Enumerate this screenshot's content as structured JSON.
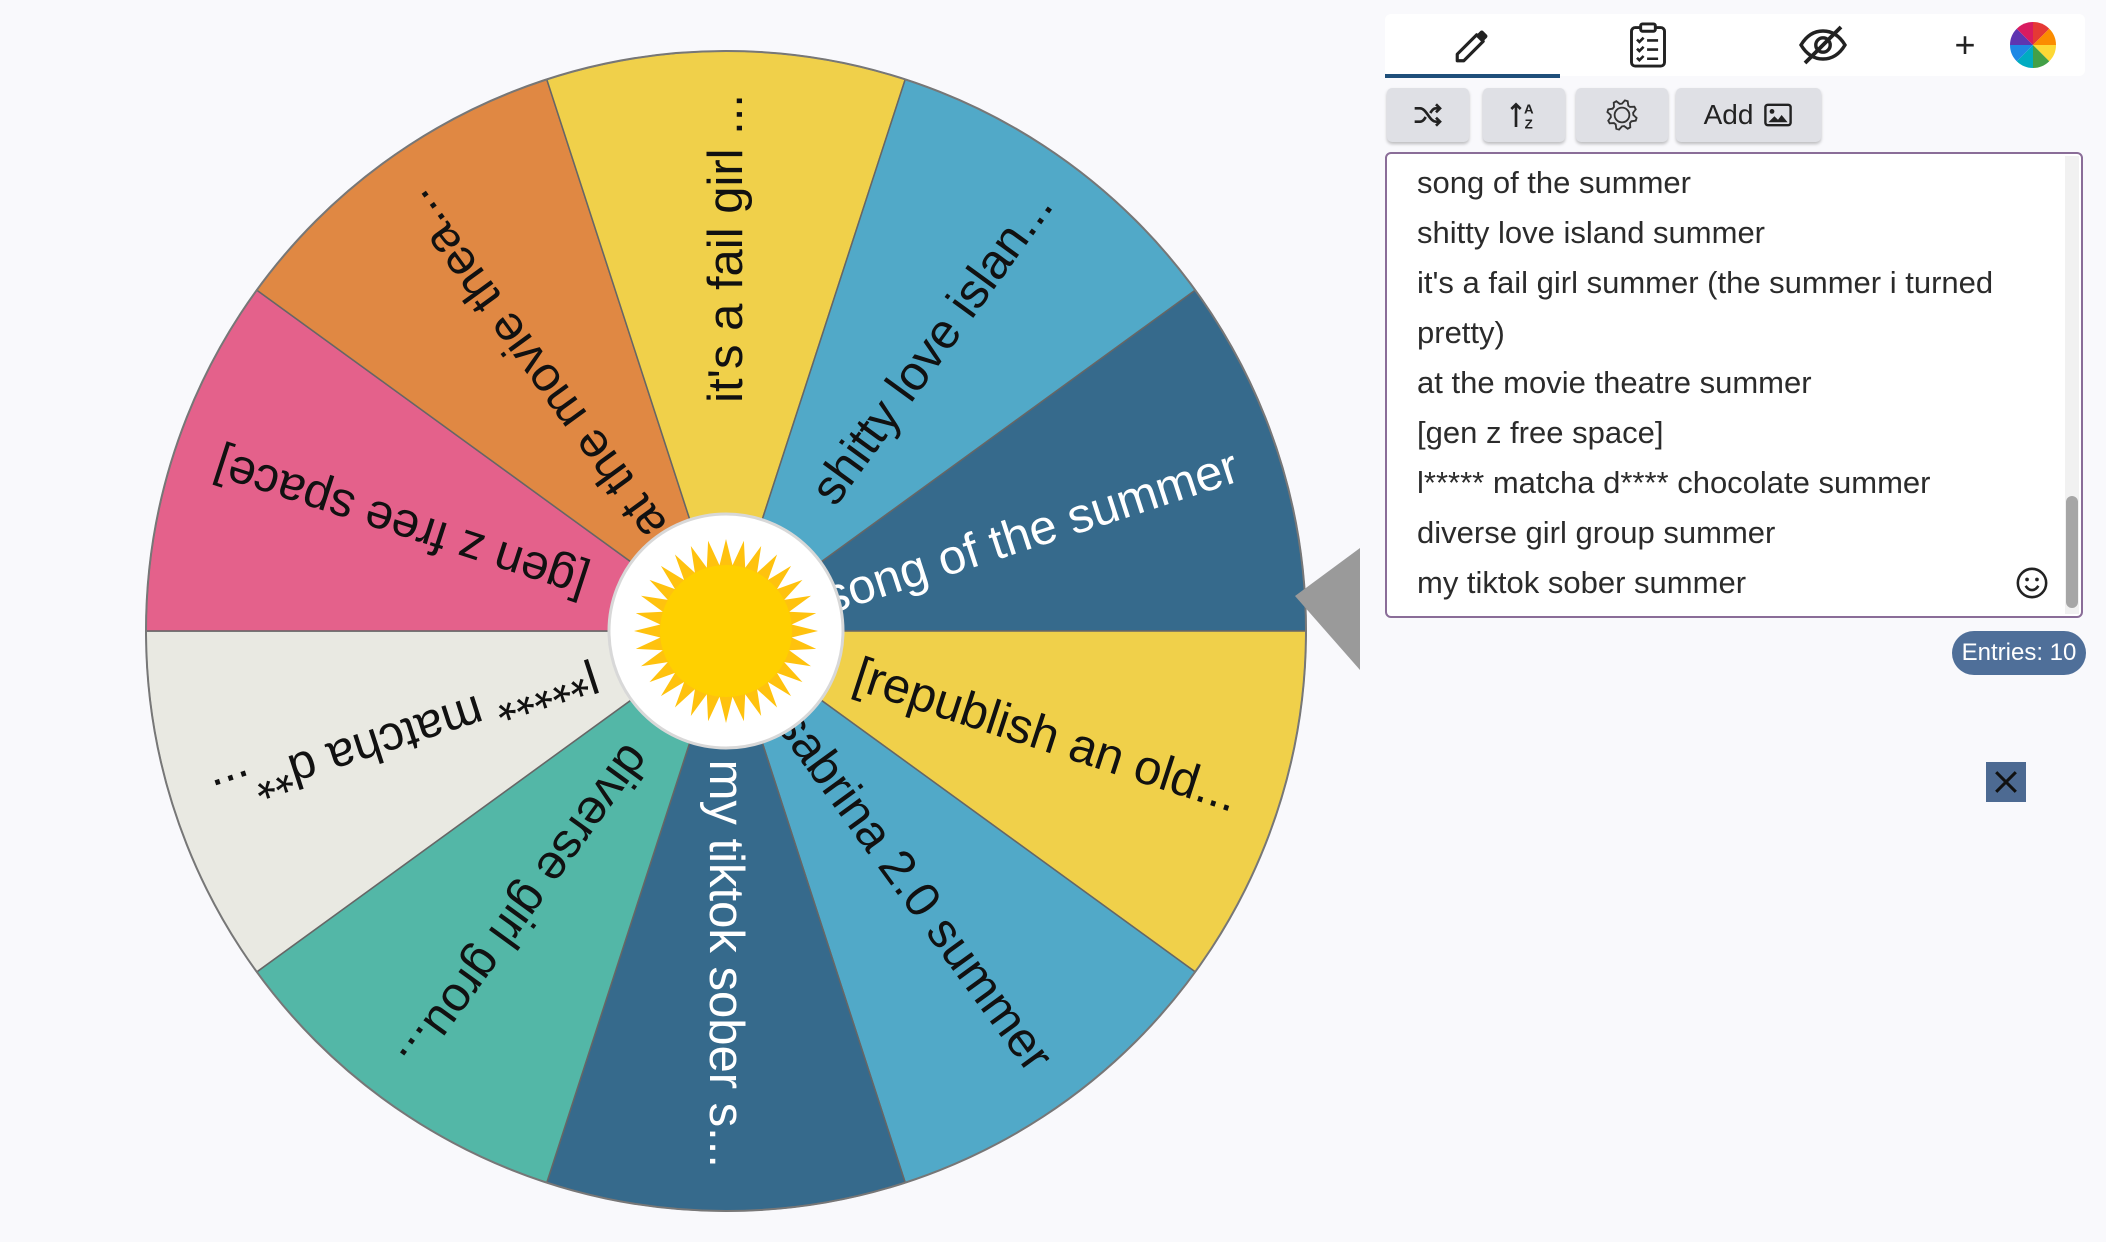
{
  "wheel": {
    "segments": [
      {
        "label": "song of the summer",
        "color": "#366a8c",
        "text_color": "#ffffff"
      },
      {
        "label": "[republish an old...",
        "color": "#f0d04a",
        "text_color": "#111111"
      },
      {
        "label": "sabrina 2.0 summer",
        "color": "#51a9c8",
        "text_color": "#111111"
      },
      {
        "label": "my tiktok sober s...",
        "color": "#366a8c",
        "text_color": "#ffffff"
      },
      {
        "label": "diverse girl grou...",
        "color": "#53b7a7",
        "text_color": "#111111"
      },
      {
        "label": "l***** matcha d**...",
        "color": "#e9e9e2",
        "text_color": "#111111"
      },
      {
        "label": "[gen z free space]",
        "color": "#e4618b",
        "text_color": "#111111"
      },
      {
        "label": "at the movie thea...",
        "color": "#e08843",
        "text_color": "#111111"
      },
      {
        "label": "it's a fail girl ...",
        "color": "#f0d04a",
        "text_color": "#111111"
      },
      {
        "label": "shitty love islan...",
        "color": "#51a9c8",
        "text_color": "#111111"
      }
    ],
    "center_icon": "sun-icon",
    "pointer_color": "#9a9a9a"
  },
  "tabs": {
    "entries_icon": "pencil-icon",
    "results_icon": "clipboard-checklist-icon",
    "hide_icon": "eye-slash-icon",
    "add_label": "+",
    "color_icon": "color-wheel-icon"
  },
  "toolbar": {
    "shuffle_icon": "shuffle-icon",
    "sort_icon": "sort-az-icon",
    "settings_icon": "gear-icon",
    "add_image_label": "Add",
    "add_image_icon": "image-icon"
  },
  "entries": [
    "song of the summer",
    "shitty love island summer",
    "it's a fail girl summer (the summer i turned",
    "pretty)",
    "at the movie theatre summer",
    "[gen z free space]",
    "l***** matcha d**** chocolate summer",
    "diverse girl group summer",
    "my tiktok sober summer"
  ],
  "entries_count": "Entries: 10",
  "close_icon": "close-icon",
  "colors": {
    "accent": "#4f6f99",
    "editor_border": "#8a6d98"
  }
}
